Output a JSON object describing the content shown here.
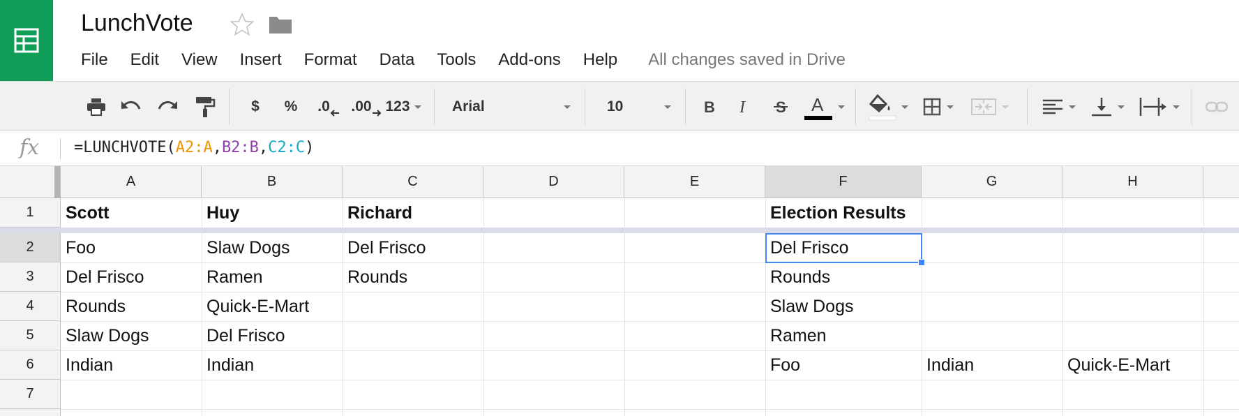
{
  "app": {
    "title": "LunchVote",
    "save_status": "All changes saved in Drive"
  },
  "menu": [
    {
      "label": "File"
    },
    {
      "label": "Edit"
    },
    {
      "label": "View"
    },
    {
      "label": "Insert"
    },
    {
      "label": "Format"
    },
    {
      "label": "Data"
    },
    {
      "label": "Tools"
    },
    {
      "label": "Add-ons"
    },
    {
      "label": "Help"
    }
  ],
  "toolbar": {
    "currency": "$",
    "percent": "%",
    "decrease_decimals": ".0",
    "increase_decimals": ".00",
    "more_formats": "123",
    "font": "Arial",
    "font_size": "10"
  },
  "formula": {
    "label": "fx",
    "prefix": "=LUNCHVOTE(",
    "ref_a": "A2:A",
    "ref_b": "B2:B",
    "ref_c": "C2:C",
    "comma": ",",
    "suffix": ")"
  },
  "columns": [
    "A",
    "B",
    "C",
    "D",
    "E",
    "F",
    "G",
    "H"
  ],
  "rows": [
    "1",
    "2",
    "3",
    "4",
    "5",
    "6",
    "7"
  ],
  "cells": {
    "A1": "Scott",
    "B1": "Huy",
    "C1": "Richard",
    "F1": "Election Results",
    "A2": "Foo",
    "B2": "Slaw Dogs",
    "C2": "Del Frisco",
    "F2": "Del Frisco",
    "A3": "Del Frisco",
    "B3": "Ramen",
    "C3": "Rounds",
    "F3": "Rounds",
    "A4": "Rounds",
    "B4": "Quick-E-Mart",
    "F4": "Slaw Dogs",
    "A5": "Slaw Dogs",
    "B5": "Del Frisco",
    "F5": "Ramen",
    "A6": "Indian",
    "B6": "Indian",
    "F6": "Foo",
    "G6": "Indian",
    "H6": "Quick-E-Mart"
  },
  "selected_cell": "F2",
  "colors": {
    "brand_green": "#0f9d58",
    "selection_blue": "#4285f4",
    "ref_a": "#f09300",
    "ref_b": "#8e3fa8",
    "ref_c": "#11a9cc"
  }
}
